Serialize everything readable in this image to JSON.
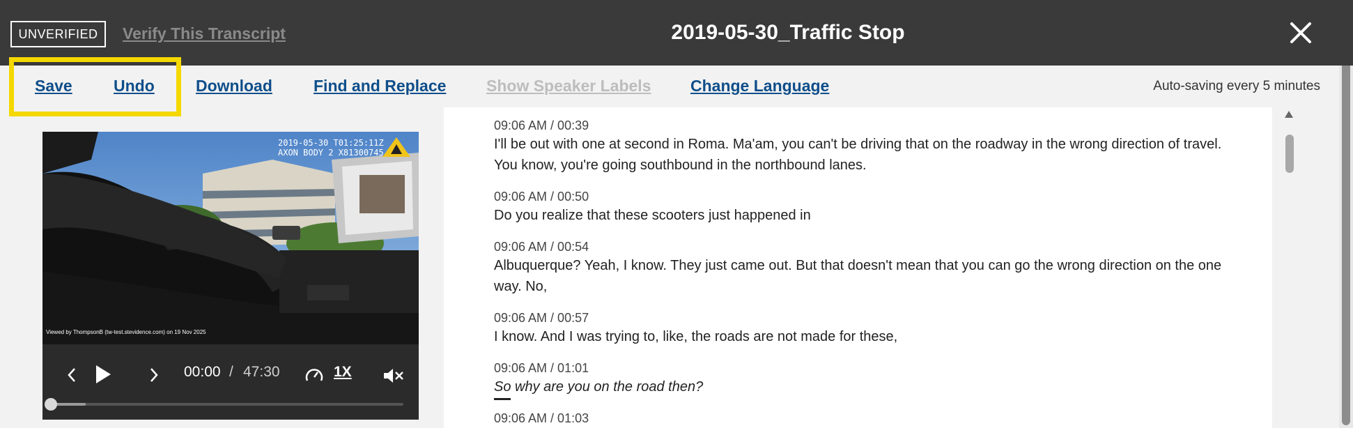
{
  "header": {
    "status_badge": "UNVERIFIED",
    "verify_link": "Verify This Transcript",
    "title": "2019-05-30_Traffic Stop"
  },
  "toolbar": {
    "save": "Save",
    "undo": "Undo",
    "download": "Download",
    "find_replace": "Find and Replace",
    "speaker_labels": "Show Speaker Labels",
    "change_language": "Change Language",
    "autosave": "Auto-saving every 5 minutes",
    "highlight_color": "#f5d800"
  },
  "video": {
    "overlay_line1": "2019-05-30 T01:25:11Z",
    "overlay_line2": "AXON BODY 2 X81300745",
    "watermark": "Viewed by ThompsonB (tw-test.stevidence.com) on 19 Nov 2025",
    "current_time": "00:00",
    "separator": "/",
    "duration": "47:30",
    "speed": "1X",
    "progress": 0.0
  },
  "transcript": [
    {
      "timestamp": "09:06 AM / 00:39",
      "text": "I'll be out with one at second in Roma. Ma'am, you can't be driving that on the roadway in the wrong direction of travel. You know, you're going southbound in the northbound lanes."
    },
    {
      "timestamp": "09:06 AM / 00:50",
      "text": "Do you realize that these scooters just happened in"
    },
    {
      "timestamp": "09:06 AM / 00:54",
      "text": "Albuquerque? Yeah, I know. They just came out. But that doesn't mean that you can go the wrong direction on the one way. No,"
    },
    {
      "timestamp": "09:06 AM / 00:57",
      "text": "I know. And I was trying to, like, the roads are not made for these,"
    },
    {
      "timestamp": "09:06 AM / 01:01",
      "text": "So why are you on the road then?"
    },
    {
      "timestamp": "09:06 AM / 01:03",
      "text": ""
    }
  ]
}
